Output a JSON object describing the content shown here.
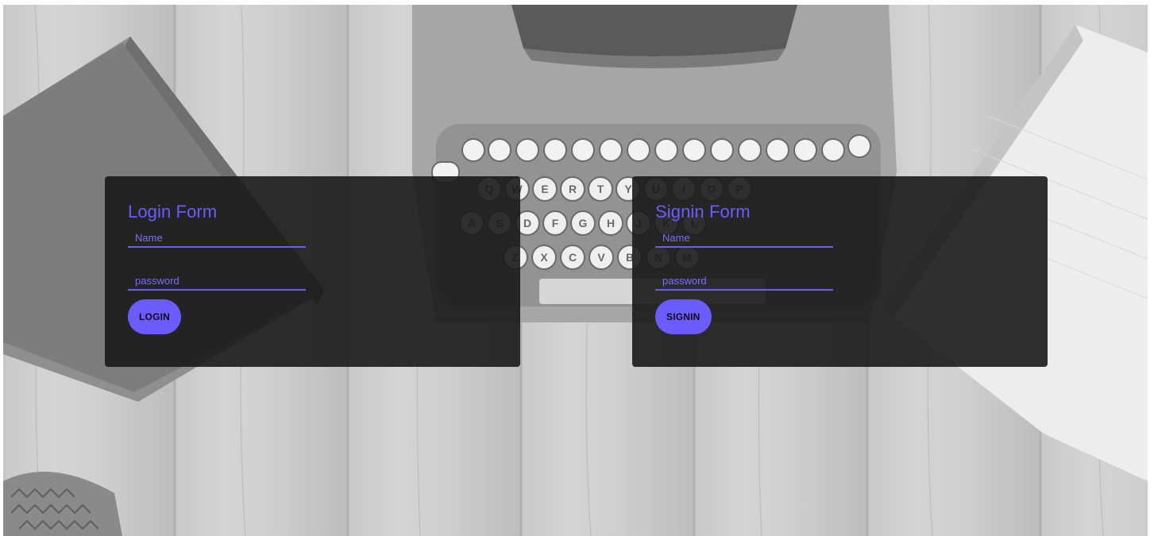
{
  "colors": {
    "accent": "#6b5cff",
    "card_bg": "#1a1a1a"
  },
  "login_form": {
    "title": "Login Form",
    "name_placeholder": "Name",
    "password_placeholder": "password",
    "button_label": "LOGIN"
  },
  "signin_form": {
    "title": "Signin Form",
    "name_placeholder": "Name",
    "password_placeholder": "password",
    "button_label": "SIGNIN"
  },
  "typewriter_keys": {
    "row1": [
      "Q",
      "W",
      "E",
      "R",
      "T",
      "Y",
      "U",
      "I",
      "O",
      "P"
    ],
    "row2": [
      "A",
      "S",
      "D",
      "F",
      "G",
      "H",
      "J",
      "K",
      "L"
    ],
    "row3": [
      "Z",
      "X",
      "C",
      "V",
      "B",
      "N",
      "M"
    ]
  }
}
